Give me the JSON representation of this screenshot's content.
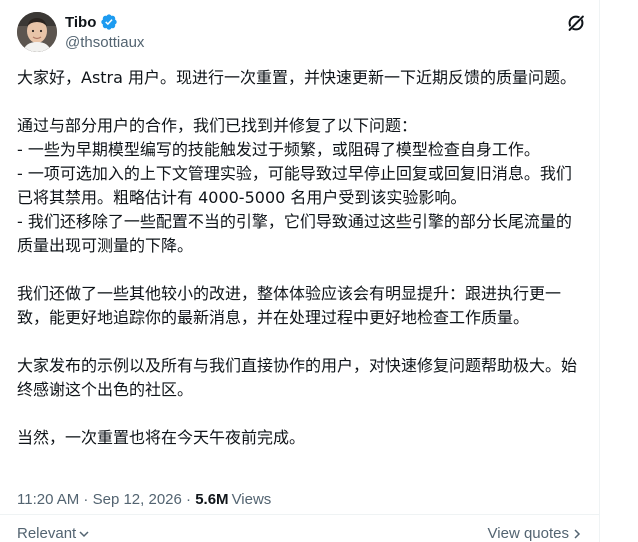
{
  "author": {
    "display_name": "Tibo",
    "handle": "@thsottiaux",
    "verified": true,
    "verified_color": "#1d9bf0"
  },
  "post": {
    "paragraphs": [
      "大家好，Astra 用户。现进行一次重置，并快速更新一下近期反馈的质量问题。",
      "",
      "通过与部分用户的合作，我们已找到并修复了以下问题：",
      "- 一些为早期模型编写的技能触发过于频繁，或阻碍了模型检查自身工作。",
      "- 一项可选加入的上下文管理实验，可能导致过早停止回复或回复旧消息。我们已将其禁用。粗略估计有 4000-5000 名用户受到该实验影响。",
      "- 我们还移除了一些配置不当的引擎，它们导致通过这些引擎的部分长尾流量的质量出现可测量的下降。",
      "",
      "我们还做了一些其他较小的改进，整体体验应该会有明显提升：跟进执行更一致，能更好地追踪你的最新消息，并在处理过程中更好地检查工作质量。",
      "",
      "大家发布的示例以及所有与我们直接协作的用户，对快速修复问题帮助极大。始终感谢这个出色的社区。",
      "",
      "当然，一次重置也将在今天午夜前完成。"
    ]
  },
  "meta": {
    "time": "11:20 AM",
    "separator": " · ",
    "date": "Sep 12, 2026",
    "views_count": "5.6M",
    "views_label": "Views"
  },
  "footer": {
    "sort_label": "Relevant",
    "quotes_label": "View quotes"
  },
  "icons": {
    "verified": "verified-badge-icon",
    "grok": "grok-icon",
    "sort": "chevron-down-icon",
    "quotes": "chevron-right-icon"
  }
}
